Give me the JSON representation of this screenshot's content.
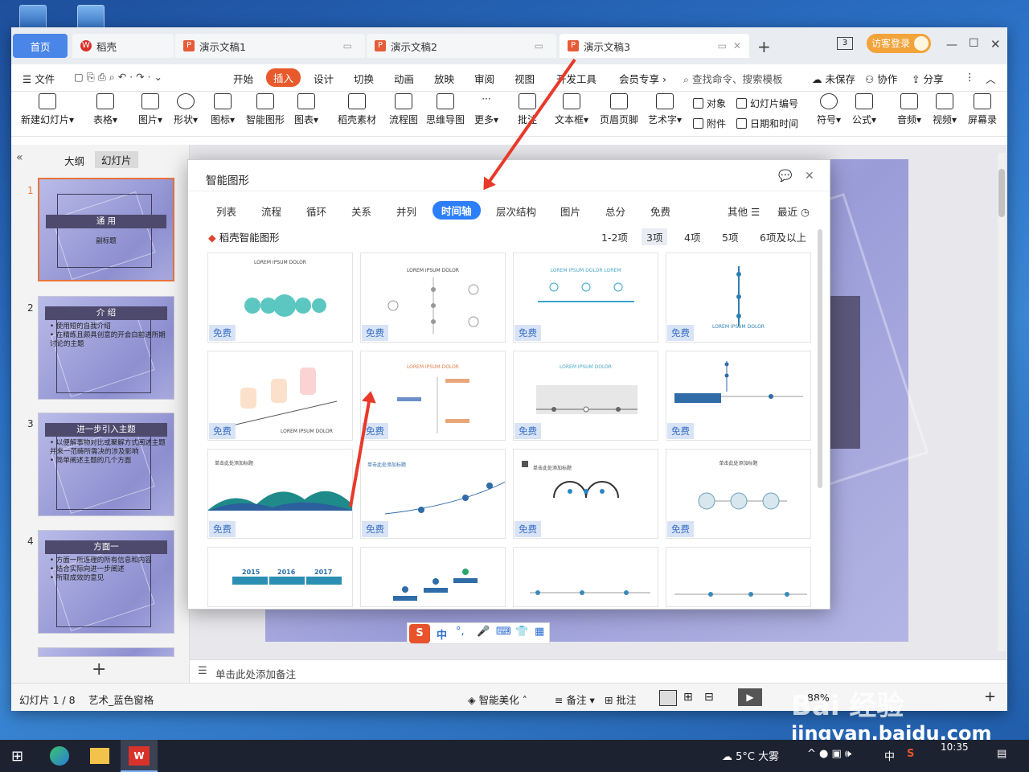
{
  "tabs": {
    "home": "首页",
    "daoke": "稻壳",
    "doc1": "演示文稿1",
    "doc2": "演示文稿2",
    "doc3": "演示文稿3",
    "page_num": "3",
    "login": "访客登录"
  },
  "menu": {
    "file": "文件",
    "start": "开始",
    "insert": "插入",
    "design": "设计",
    "switch": "切换",
    "anim": "动画",
    "show": "放映",
    "review": "审阅",
    "view": "视图",
    "dev": "开发工具",
    "vip": "会员专享",
    "search": "查找命令、搜索模板",
    "unsaved": "未保存",
    "collab": "协作",
    "share": "分享"
  },
  "ribbon": {
    "new_slide": "新建幻灯片",
    "table": "表格",
    "picture": "图片",
    "shape": "形状",
    "icon": "图标",
    "smart": "智能图形",
    "chart": "图表",
    "material": "稻壳素材",
    "flow": "流程图",
    "mind": "思维导图",
    "more": "更多",
    "comment": "批注",
    "textbox": "文本框",
    "header": "页眉页脚",
    "art": "艺术字",
    "object": "对象",
    "slide_no": "幻灯片编号",
    "attach": "附件",
    "datetime": "日期和时间",
    "symbol": "符号",
    "formula": "公式",
    "audio": "音频",
    "video": "视频",
    "screen": "屏幕录"
  },
  "leftpane": {
    "outline": "大纲",
    "slides": "幻灯片",
    "thumbs": [
      {
        "num": "1",
        "title": "通  用",
        "sub": "副标题"
      },
      {
        "num": "2",
        "title": "介  绍",
        "lines": [
          "• 使用短的自我介绍",
          "• 在精练且颇具创意的开会白前进所期讨论的主题"
        ]
      },
      {
        "num": "3",
        "title": "进一步引入主题",
        "lines": [
          "• 以便解事物对比或聚解方式阐述主题并来一范畴所需决的涉及影响",
          "• 简单阐述主题的几个方面"
        ]
      },
      {
        "num": "4",
        "title": "方面一",
        "lines": [
          "• 方面一所连理的所有信息和内容",
          "• 结合实际向进一步阐述",
          "• 所取成效的意见"
        ]
      }
    ]
  },
  "notes": "单击此处添加备注",
  "status": {
    "slide": "幻灯片 1 / 8",
    "theme": "艺术_蓝色窗格",
    "beautify": "智能美化",
    "notes": "备注",
    "comment": "批注",
    "zoom": "88%"
  },
  "dialog": {
    "title": "智能图形",
    "categories": [
      "列表",
      "流程",
      "循环",
      "关系",
      "并列",
      "时间轴",
      "层次结构",
      "图片",
      "总分",
      "免费"
    ],
    "other": "其他",
    "recent": "最近",
    "brand": "稻壳智能图形",
    "counts": [
      "1-2项",
      "3项",
      "4项",
      "5项",
      "6项及以上"
    ],
    "free": "免费"
  },
  "card_texts": {
    "lorem": "LOREM IPSUM DOLOR",
    "lorem2": "LOREM IPSUM DOLOR LOREM",
    "lorem_ipsum": "Lorem ipsum",
    "title_cn": "单击此处添加标题",
    "years": [
      "2015",
      "2016",
      "2017"
    ]
  },
  "ime": {
    "lang": "中"
  },
  "taskbar": {
    "weather": "5°C 大雾",
    "lang": "中",
    "time": "10:35"
  },
  "watermark": {
    "brand": "Bai 经验",
    "url": "jingyan.baidu.com"
  },
  "colors": {
    "accent_orange": "#e85a2c",
    "accent_blue": "#2d7ff9",
    "arrow_red": "#e8392a",
    "slide_purple": "#9a9cd8"
  }
}
